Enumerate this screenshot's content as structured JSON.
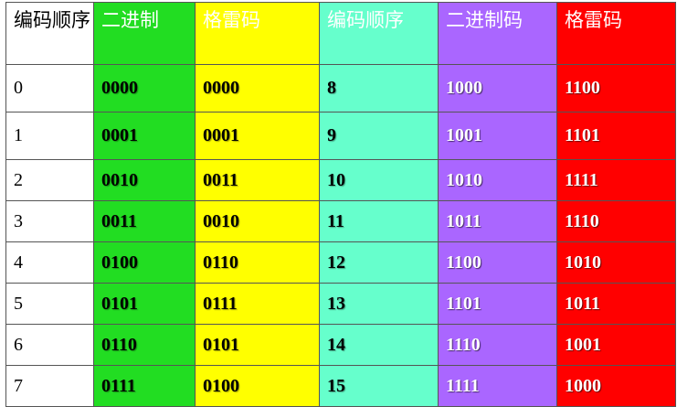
{
  "table": {
    "headers": [
      "编码顺序",
      "二进制",
      "格雷码",
      "编码顺序",
      "二进制码",
      "格雷码"
    ],
    "rows": [
      [
        "0",
        "0000",
        "0000",
        "8",
        "1000",
        "1100"
      ],
      [
        "1",
        "0001",
        "0001",
        "9",
        "1001",
        "1101"
      ],
      [
        "2",
        "0010",
        "0011",
        "10",
        "1010",
        "1111"
      ],
      [
        "3",
        "0011",
        "0010",
        "11",
        "1011",
        "1110"
      ],
      [
        "4",
        "0100",
        "0110",
        "12",
        "1100",
        "1010"
      ],
      [
        "5",
        "0101",
        "0111",
        "13",
        "1101",
        "1011"
      ],
      [
        "6",
        "0110",
        "0101",
        "14",
        "1110",
        "1001"
      ],
      [
        "7",
        "0111",
        "0100",
        "15",
        "1111",
        "1000"
      ]
    ]
  },
  "colors": {
    "col1": "#ffffff",
    "col2": "#22dd22",
    "col3": "#ffff00",
    "col4": "#66ffcc",
    "col5": "#aa66ff",
    "col6": "#ff0000",
    "border": "#555555"
  }
}
